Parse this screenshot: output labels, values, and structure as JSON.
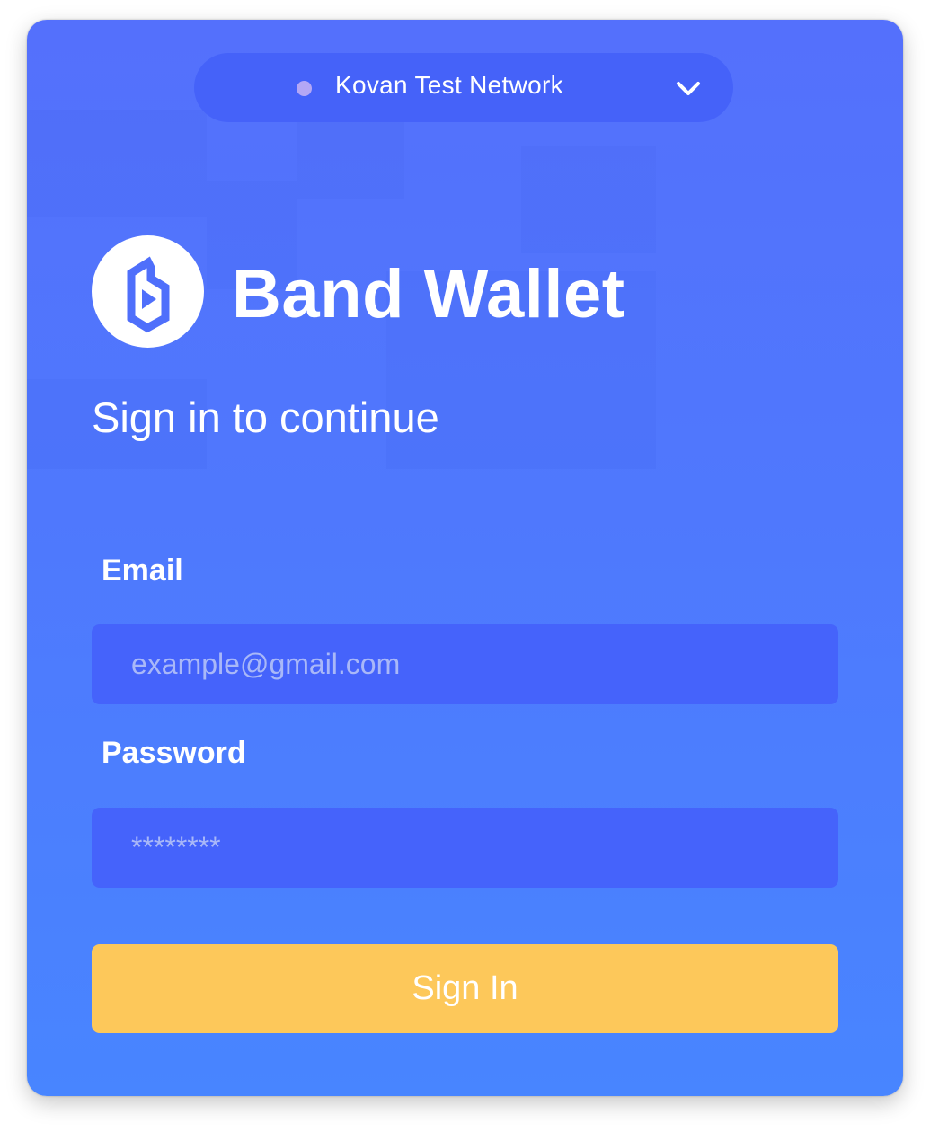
{
  "network": {
    "label": "Kovan Test Network",
    "status_color": "#b4a7f5",
    "dropdown_icon": "chevron-down-icon"
  },
  "brand": {
    "name": "Band Wallet",
    "logo_icon": "band-logo-icon"
  },
  "subtitle": "Sign in to continue",
  "form": {
    "email": {
      "label": "Email",
      "placeholder": "example@gmail.com",
      "value": ""
    },
    "password": {
      "label": "Password",
      "placeholder": "********",
      "value": ""
    },
    "submit_label": "Sign In"
  },
  "colors": {
    "background": "#4f78fd",
    "input_background": "#4563fb",
    "accent_button": "#fdc85a",
    "text": "#ffffff"
  }
}
